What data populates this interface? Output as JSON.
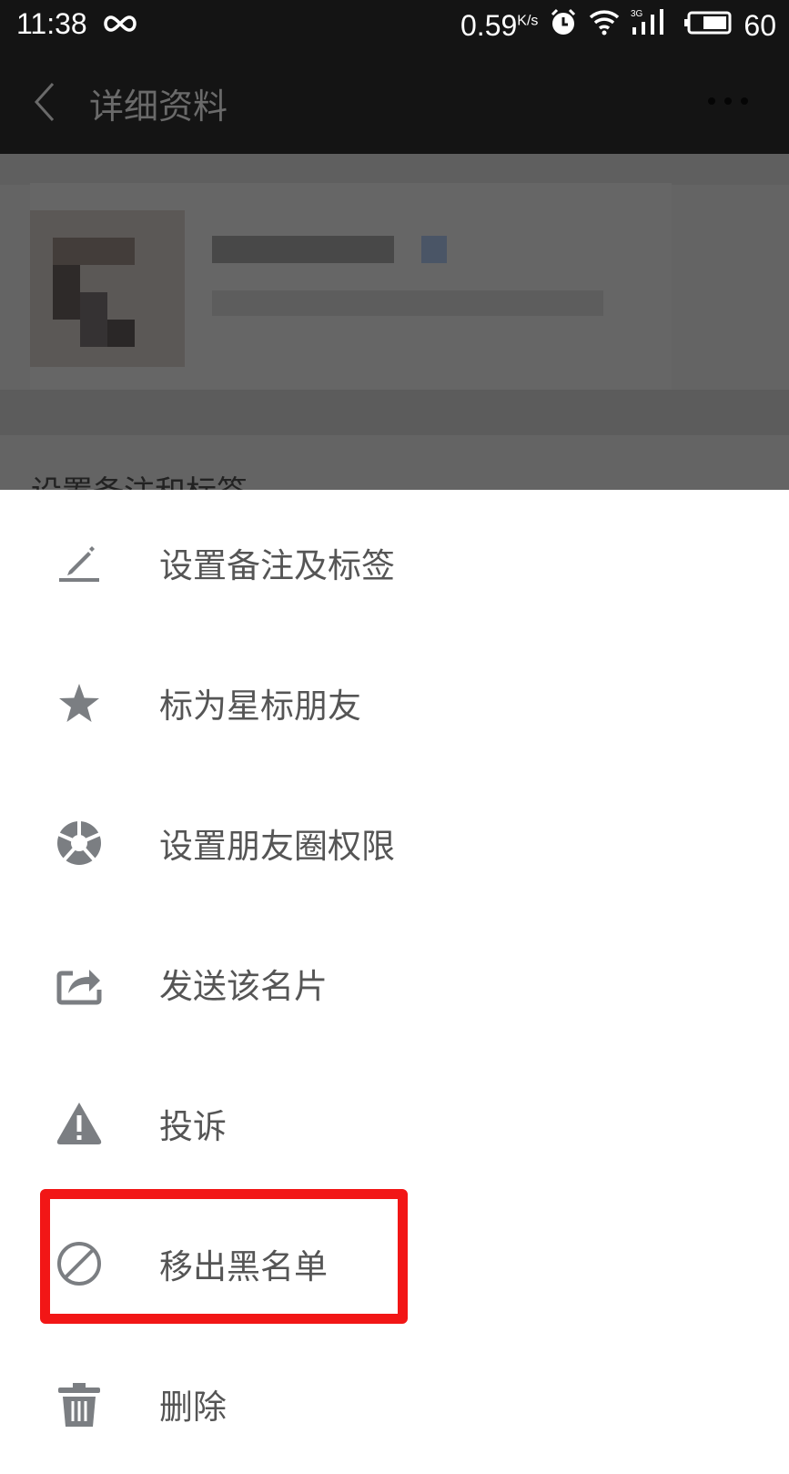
{
  "status_bar": {
    "time": "11:38",
    "loop_icon": "infinity-icon",
    "speed": "0.59",
    "speed_unit": "K/s",
    "alarm_icon": "alarm-icon",
    "wifi_icon": "wifi-icon",
    "network_label": "3G",
    "battery_level": "60"
  },
  "app_bar": {
    "back_icon": "chevron-left-icon",
    "title": "详细资料",
    "more_icon": "more-horizontal-icon"
  },
  "background": {
    "partial_label": "设置备注和标签"
  },
  "menu": {
    "items": [
      {
        "label": "设置备注及标签",
        "icon": "edit-pencil-icon"
      },
      {
        "label": "标为星标朋友",
        "icon": "star-icon"
      },
      {
        "label": "设置朋友圈权限",
        "icon": "aperture-icon"
      },
      {
        "label": "发送该名片",
        "icon": "share-icon"
      },
      {
        "label": "投诉",
        "icon": "warning-icon"
      },
      {
        "label": "移出黑名单",
        "icon": "block-icon"
      },
      {
        "label": "删除",
        "icon": "trash-icon"
      }
    ],
    "highlighted_item": "移出黑名单"
  },
  "colors": {
    "status_bar_bg": "#141414",
    "icon_gray": "#7b7e82",
    "highlight_red": "#f21616",
    "overlay_gray": "#646464"
  }
}
